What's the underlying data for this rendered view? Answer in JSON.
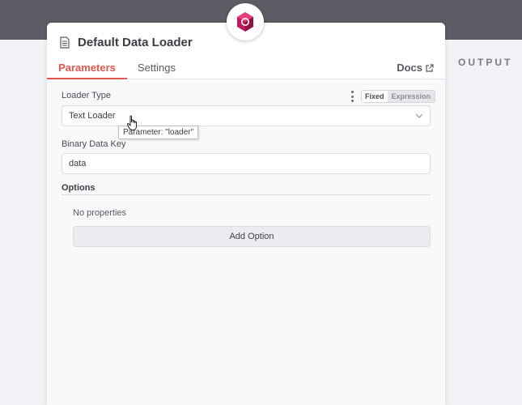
{
  "output_label": "OUTPUT",
  "node_icon": "openai-logo-icon",
  "panel": {
    "title": "Default Data Loader",
    "title_icon": "document-icon",
    "tabs": [
      {
        "label": "Parameters",
        "active": true
      },
      {
        "label": "Settings",
        "active": false
      }
    ],
    "docs_label": "Docs",
    "docs_icon": "external-link-icon"
  },
  "parameters": {
    "loader_type": {
      "label": "Loader Type",
      "value": "Text Loader",
      "mode_options": [
        "Fixed",
        "Expression"
      ],
      "selected_mode": "Fixed",
      "tooltip": "Parameter: \"loader\""
    },
    "binary_data_key": {
      "label": "Binary Data Key",
      "value": "data"
    },
    "options": {
      "title": "Options",
      "empty_text": "No properties",
      "add_button_label": "Add Option"
    }
  },
  "colors": {
    "accent": "#e2574c",
    "topbar": "#5d5b63"
  }
}
